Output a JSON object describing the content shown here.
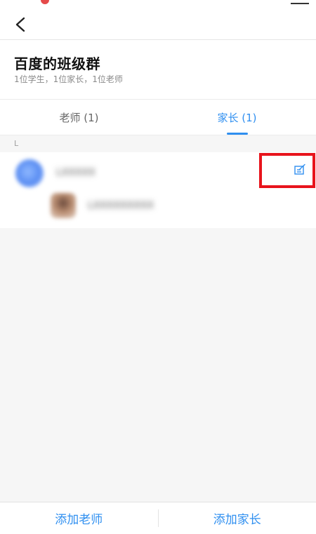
{
  "nav": {
    "back_icon": "chevron-left-icon"
  },
  "group": {
    "title": "百度的班级群",
    "subtitle": "1位学生，1位家长，1位老师"
  },
  "tabs": [
    {
      "label": "老师 (1)",
      "active": false
    },
    {
      "label": "家长 (1)",
      "active": true
    }
  ],
  "list": {
    "section_letter": "L",
    "parent": {
      "name": "LXXXXX",
      "edit_icon": "edit-icon"
    },
    "student": {
      "name": "LXXXXXXXXX"
    }
  },
  "actions": {
    "add_teacher": "添加老师",
    "add_parent": "添加家长"
  },
  "colors": {
    "accent": "#2f8ff0",
    "highlight": "#e8141c"
  }
}
